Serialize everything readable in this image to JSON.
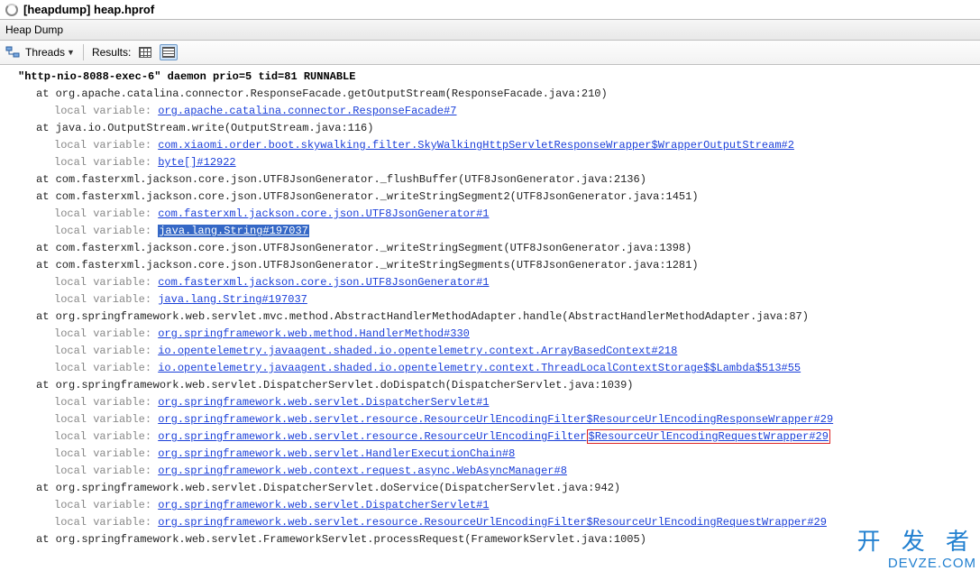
{
  "title_prefix": "[heapdump]",
  "title_file": "heap.hprof",
  "subbar": "Heap Dump",
  "toolbar": {
    "threads_label": "Threads",
    "results_label": "Results:"
  },
  "thread_header": "\"http-nio-8088-exec-6\" daemon prio=5 tid=81 RUNNABLE",
  "frames": [
    {
      "at": "at org.apache.catalina.connector.ResponseFacade.getOutputStream(ResponseFacade.java:210)",
      "locals": [
        {
          "link": "org.apache.catalina.connector.ResponseFacade#7"
        }
      ]
    },
    {
      "at": "at java.io.OutputStream.write(OutputStream.java:116)",
      "locals": [
        {
          "link": "com.xiaomi.order.boot.skywalking.filter.SkyWalkingHttpServletResponseWrapper$WrapperOutputStream#2"
        },
        {
          "link": "byte[]#12922"
        }
      ]
    },
    {
      "at": "at com.fasterxml.jackson.core.json.UTF8JsonGenerator._flushBuffer(UTF8JsonGenerator.java:2136)",
      "locals": []
    },
    {
      "at": "at com.fasterxml.jackson.core.json.UTF8JsonGenerator._writeStringSegment2(UTF8JsonGenerator.java:1451)",
      "locals": [
        {
          "link": "com.fasterxml.jackson.core.json.UTF8JsonGenerator#1"
        },
        {
          "link": "java.lang.String#197037",
          "selected": true
        }
      ]
    },
    {
      "at": "at com.fasterxml.jackson.core.json.UTF8JsonGenerator._writeStringSegment(UTF8JsonGenerator.java:1398)",
      "locals": []
    },
    {
      "at": "at com.fasterxml.jackson.core.json.UTF8JsonGenerator._writeStringSegments(UTF8JsonGenerator.java:1281)",
      "locals": [
        {
          "link": "com.fasterxml.jackson.core.json.UTF8JsonGenerator#1"
        },
        {
          "link": "java.lang.String#197037"
        }
      ]
    },
    {
      "at": "at org.springframework.web.servlet.mvc.method.AbstractHandlerMethodAdapter.handle(AbstractHandlerMethodAdapter.java:87)",
      "locals": [
        {
          "link": "org.springframework.web.method.HandlerMethod#330"
        },
        {
          "link": "io.opentelemetry.javaagent.shaded.io.opentelemetry.context.ArrayBasedContext#218"
        },
        {
          "link": "io.opentelemetry.javaagent.shaded.io.opentelemetry.context.ThreadLocalContextStorage$$Lambda$513#55"
        }
      ]
    },
    {
      "at": "at org.springframework.web.servlet.DispatcherServlet.doDispatch(DispatcherServlet.java:1039)",
      "locals": [
        {
          "link": "org.springframework.web.servlet.DispatcherServlet#1"
        },
        {
          "link": "org.springframework.web.servlet.resource.ResourceUrlEncodingFilter$ResourceUrlEncodingResponseWrapper#29"
        },
        {
          "prelink": "org.springframework.web.servlet.resource.ResourceUrlEncodingFilter",
          "boxedSuffix": "$ResourceUrlEncodingRequestWrapper#29",
          "boxed": true
        },
        {
          "link": "org.springframework.web.servlet.HandlerExecutionChain#8"
        },
        {
          "link": "org.springframework.web.context.request.async.WebAsyncManager#8"
        }
      ]
    },
    {
      "at": "at org.springframework.web.servlet.DispatcherServlet.doService(DispatcherServlet.java:942)",
      "locals": [
        {
          "link": "org.springframework.web.servlet.DispatcherServlet#1"
        },
        {
          "link": "org.springframework.web.servlet.resource.ResourceUrlEncodingFilter$ResourceUrlEncodingRequestWrapper#29"
        }
      ]
    },
    {
      "at": "at org.springframework.web.servlet.FrameworkServlet.processRequest(FrameworkServlet.java:1005)",
      "locals": []
    }
  ],
  "lv_label": "local variable:",
  "watermark": {
    "cn": "开 发 者",
    "en": "DEVZE.COM"
  }
}
